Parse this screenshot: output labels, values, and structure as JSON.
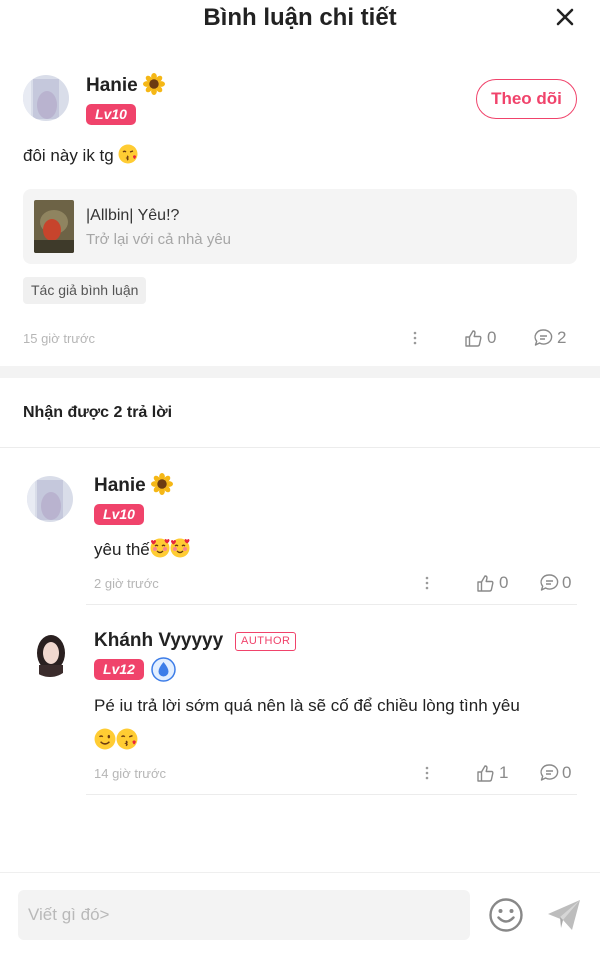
{
  "header": {
    "title": "Bình luận chi tiết"
  },
  "comment": {
    "username": "Hanie",
    "level": "Lv10",
    "follow_label": "Theo dõi",
    "text": "đôi này ik tg",
    "song": {
      "title": "|Allbin| Yêu!?",
      "subtitle": "Trở lại với cả nhà yêu"
    },
    "tag": "Tác giả bình luận",
    "time": "15 giờ trước",
    "likes": "0",
    "replies": "2"
  },
  "replies_section": {
    "title": "Nhận được 2 trả lời"
  },
  "replies": [
    {
      "username": "Hanie",
      "level": "Lv10",
      "text": "yêu thế",
      "time": "2 giờ trước",
      "likes": "0",
      "comments": "0"
    },
    {
      "username": "Khánh Vyyyyy",
      "author_badge": "AUTHOR",
      "level": "Lv12",
      "text": "Pé iu trả lời sớm quá nên là sẽ cố để chiều lòng tình yêu",
      "time": "14 giờ trước",
      "likes": "1",
      "comments": "0"
    }
  ],
  "composer": {
    "placeholder": "Viết gì đó>"
  },
  "colors": {
    "accent": "#f0436b",
    "muted": "#b6b6b6"
  }
}
